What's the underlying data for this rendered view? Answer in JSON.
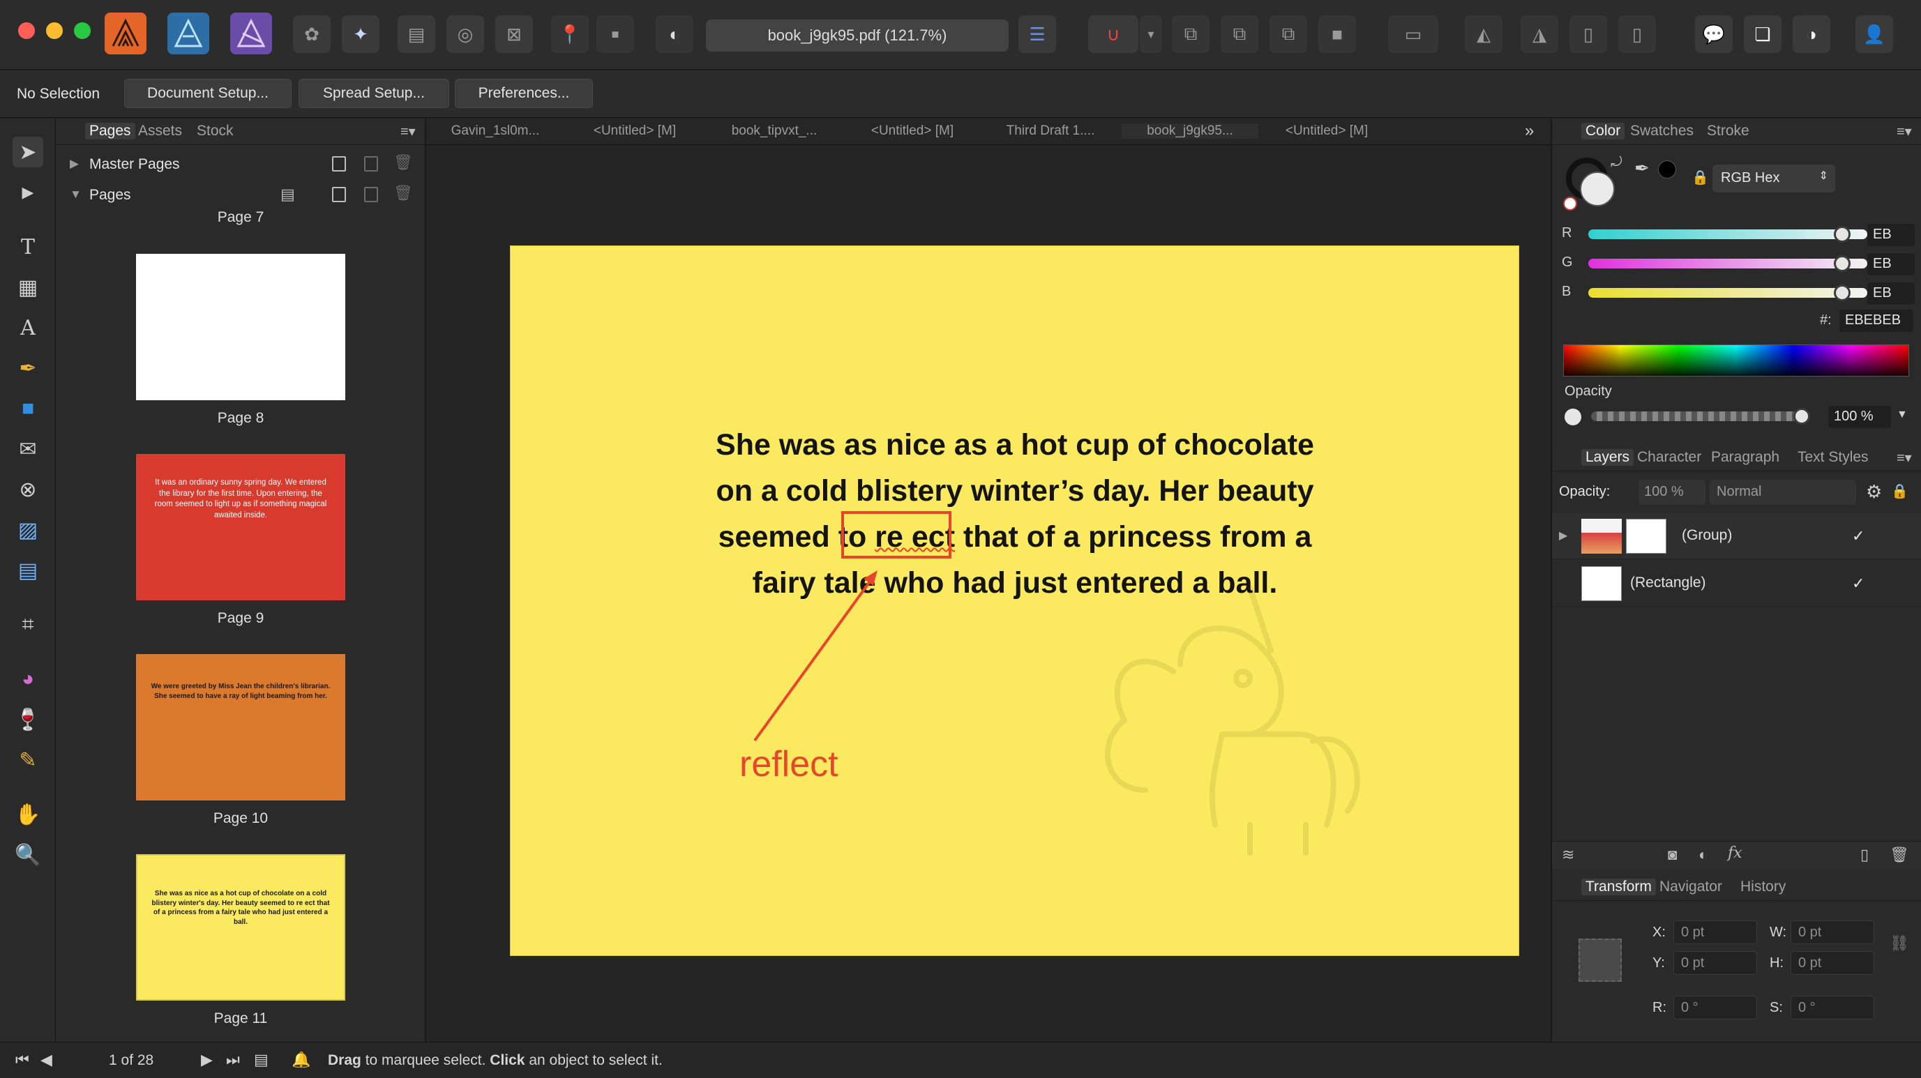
{
  "toolbar": {
    "document_title": "book_j9gk95.pdf (121.7%)",
    "colors": {
      "close": "#ff5f57",
      "minimize": "#febc2e",
      "zoom": "#28c840",
      "publisher_brand": "#e56428",
      "designer_brand": "#2e6ea6",
      "photo_brand": "#6a4da8"
    }
  },
  "context": {
    "selection_label": "No Selection",
    "document_setup": "Document Setup...",
    "spread_setup": "Spread Setup...",
    "preferences": "Preferences..."
  },
  "pages_panel": {
    "tabs": [
      "Pages",
      "Assets",
      "Stock"
    ],
    "master_pages": "Master Pages",
    "pages": "Pages",
    "top_label": "Page 7",
    "thumbs": [
      {
        "label": "Page 8",
        "color": "#ffffff",
        "text": ""
      },
      {
        "label": "Page 9",
        "color": "#d93a2e",
        "text": "It was an ordinary sunny spring day. We entered the library for the first time. Upon entering, the room seemed to light up as if something magical awaited inside."
      },
      {
        "label": "Page 10",
        "color": "#db7a2c",
        "text": "We were greeted by Miss Jean the children's librarian. She seemed to have a ray of light beaming from her."
      },
      {
        "label": "Page 11",
        "color": "#fbe95f",
        "text": "She was as nice as a hot cup of chocolate on a cold blistery winter's day. Her beauty seemed to re  ect that of a princess from a fairy tale who had just entered a ball."
      }
    ]
  },
  "doc_tabs": [
    "Gavin_1sl0m...",
    "<Untitled> [M]",
    "book_tipvxt_...",
    "<Untitled> [M]",
    "Third Draft 1....",
    "book_j9gk95...",
    "<Untitled> [M]"
  ],
  "canvas": {
    "page_color": "#fbe95f",
    "lines": [
      "She was as nice as a hot cup of chocolate",
      "on a cold blistery winter’s day. Her beauty",
      "fairy tale who had just entered a ball."
    ],
    "line3_pre": "seemed to ",
    "line3_broken": "re  ect",
    "line3_post": " that of a princess from a",
    "annotation": "reflect",
    "annotation_color": "#e8462a"
  },
  "color_panel": {
    "tabs": [
      "Color",
      "Swatches",
      "Stroke"
    ],
    "mode": "RGB Hex",
    "channels": [
      {
        "label": "R",
        "value": "EB",
        "level": 0.92
      },
      {
        "label": "G",
        "value": "EB",
        "level": 0.92
      },
      {
        "label": "B",
        "value": "EB",
        "level": 0.92
      }
    ],
    "hash_label": "#:",
    "hex": "EBEBEB",
    "opacity_label": "Opacity",
    "opacity_value": "100 %"
  },
  "layers_panel": {
    "tabs": [
      "Layers",
      "Character",
      "Paragraph",
      "Text Styles"
    ],
    "opacity_label": "Opacity:",
    "opacity_value": "100 %",
    "blend": "Normal",
    "layers": [
      {
        "name": "(Group)"
      },
      {
        "name": "(Rectangle)"
      }
    ]
  },
  "transform_panel": {
    "tabs": [
      "Transform",
      "Navigator",
      "History"
    ],
    "x_label": "X:",
    "x": "0 pt",
    "y_label": "Y:",
    "y": "0 pt",
    "w_label": "W:",
    "w": "0 pt",
    "h_label": "H:",
    "h": "0 pt",
    "r_label": "R:",
    "r": "0 °",
    "s_label": "S:",
    "s": "0 °"
  },
  "status": {
    "page_count": "1 of 28",
    "hint_drag": "Drag",
    "hint_mid": " to marquee select. ",
    "hint_click": "Click",
    "hint_end": " an object to select it."
  }
}
